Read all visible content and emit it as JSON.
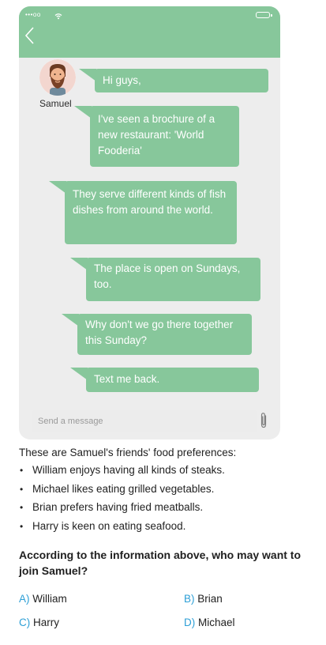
{
  "phone": {
    "status_signal": "•••oo",
    "message_placeholder": "Send a message",
    "colors": {
      "header": "#87c79b",
      "bubble": "#87c79b",
      "chat_background": "#ededed"
    },
    "back_icon": "chevron-left-icon",
    "attach_icon": "paperclip-icon"
  },
  "chat": {
    "sender": "Samuel",
    "messages": [
      "Hi guys,",
      "I've seen a brochure of a new restaurant: 'World Fooderia'",
      "They serve different kinds of fish dishes from around the world.",
      "The place is open on Sundays, too.",
      "Why don't we go there together this Sunday?",
      "Text me back."
    ]
  },
  "exercise": {
    "intro": "These are Samuel's friends' food preferences:",
    "preferences": [
      "William enjoys having all kinds of steaks.",
      "Michael likes eating grilled vegetables.",
      "Brian prefers having fried meatballs.",
      "Harry is keen on eating seafood."
    ],
    "question": "According to the information above, who may want to join Samuel?",
    "options": [
      {
        "letter": "A)",
        "text": "William"
      },
      {
        "letter": "B)",
        "text": "Brian"
      },
      {
        "letter": "C)",
        "text": "Harry"
      },
      {
        "letter": "D)",
        "text": "Michael"
      }
    ],
    "option_letter_color": "#2d9fd6"
  }
}
